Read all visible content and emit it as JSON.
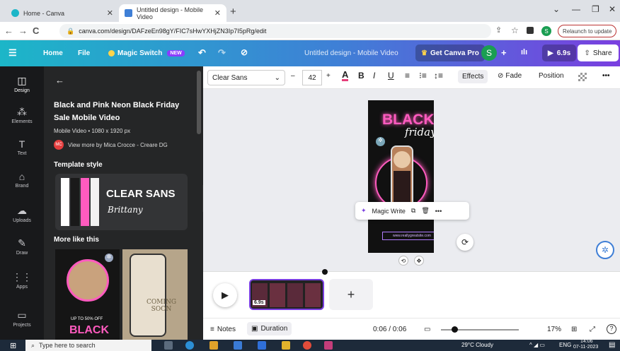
{
  "browser": {
    "tabs": [
      {
        "title": "Home - Canva",
        "active": false
      },
      {
        "title": "Untitled design - Mobile Video",
        "active": true
      }
    ],
    "url": "canva.com/design/DAFzeEn98gY/FIC7sHwYXHjZN3Ip7I5pRg/edit",
    "relaunch_label": "Relaunch to update",
    "profile_letter": "S"
  },
  "canva_header": {
    "menu_icon": "hamburger-icon",
    "home": "Home",
    "file": "File",
    "magic_switch": "Magic Switch",
    "new_badge": "NEW",
    "doc_title": "Untitled design - Mobile Video",
    "get_pro": "Get Canva Pro",
    "avatar_letter": "S",
    "duration": "6.9s",
    "share": "Share"
  },
  "rail": [
    {
      "label": "Design",
      "icon": "layout-icon"
    },
    {
      "label": "Elements",
      "icon": "shapes-icon"
    },
    {
      "label": "Text",
      "icon": "text-icon"
    },
    {
      "label": "Brand",
      "icon": "brand-icon"
    },
    {
      "label": "Uploads",
      "icon": "upload-icon"
    },
    {
      "label": "Draw",
      "icon": "pen-icon"
    },
    {
      "label": "Apps",
      "icon": "grid-icon"
    },
    {
      "label": "Projects",
      "icon": "folder-icon"
    }
  ],
  "panel": {
    "title": "Black and Pink Neon Black Friday Sale Mobile Video",
    "subtitle": "Mobile Video • 1080 x 1920 px",
    "creator_initials": "MC",
    "creator": "View more by Mica Crocce - Creare DG",
    "template_style_heading": "Template style",
    "font_primary": "CLEAR SANS",
    "font_secondary": "Brittany",
    "style_colors": [
      "#ffffff",
      "#1a1a1a",
      "#ff5bbf",
      "#f2f2f2"
    ],
    "more_heading": "More like this",
    "thumb1_upto": "UP TO 50% OFF",
    "thumb1_big": "BLACK",
    "thumb2_text": "COMING SOON"
  },
  "toolbar": {
    "font": "Clear Sans",
    "minus": "–",
    "size": "42",
    "plus": "+",
    "text_color_letter": "A",
    "bold": "B",
    "italic": "I",
    "underline": "U",
    "effects": "Effects",
    "fade": "Fade",
    "position": "Position",
    "more": "•••"
  },
  "design": {
    "black": "BLACK",
    "friday": "friday",
    "url_text": "www.reallygreatsite.com"
  },
  "magic_write": {
    "label": "Magic Write",
    "more": "•••"
  },
  "timeline": {
    "clip_duration": "6.9s",
    "add": "+"
  },
  "bottom": {
    "notes": "Notes",
    "duration": "Duration",
    "time": "0:06 / 0:06",
    "zoom": "17%",
    "zoom_fraction": 0.17,
    "help": "?"
  },
  "taskbar": {
    "search_placeholder": "Type here to search",
    "weather": "29°C Cloudy",
    "lang": "ENG",
    "time": "14:06",
    "date": "07-11-2023"
  },
  "colors": {
    "canva_purple": "#7a3fe0",
    "canva_teal": "#1cb6c8",
    "neon_pink": "#ff5bbf",
    "panel_bg": "#252627"
  }
}
